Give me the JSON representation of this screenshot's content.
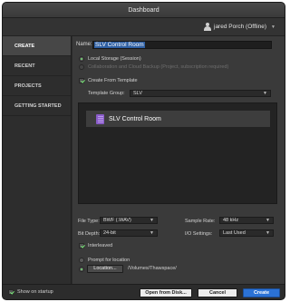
{
  "window": {
    "title": "Dashboard"
  },
  "user": {
    "name": "jared Porch (Offline)"
  },
  "sidebar": {
    "items": [
      {
        "label": "CREATE"
      },
      {
        "label": "RECENT"
      },
      {
        "label": "PROJECTS"
      },
      {
        "label": "GETTING STARTED"
      }
    ]
  },
  "form": {
    "name_label": "Name:",
    "name_value": "SLV Control Room",
    "storage": {
      "local": "Local Storage (Session)",
      "cloud": "Collaboration and Cloud Backup (Project, subscription required)"
    },
    "create_from_template": "Create From Template",
    "template_group_label": "Template Group:",
    "template_group_value": "SLV",
    "template_item": "SLV Control Room",
    "file_type_label": "File Type:",
    "file_type_value": "BWF (.WAV)",
    "bit_depth_label": "Bit Depth:",
    "bit_depth_value": "24-bit",
    "sample_rate_label": "Sample Rate:",
    "sample_rate_value": "48 kHz",
    "io_settings_label": "I/O Settings:",
    "io_settings_value": "Last Used",
    "interleaved": "Interleaved",
    "prompt_for_location": "Prompt for location",
    "location_button": "Location...",
    "location_path": "/Volumes/Thawspace/"
  },
  "footer": {
    "show_on_startup": "Show on startup",
    "open_from_disk": "Open from Disk...",
    "cancel": "Cancel",
    "create": "Create"
  },
  "colors": {
    "accent": "#2b72d6",
    "selection": "#2e5fa3",
    "check": "#7cf07c"
  },
  "icons": [
    "person-icon",
    "chevron-down-icon",
    "session-document-icon",
    "checkmark-icon",
    "radio-icon"
  ]
}
